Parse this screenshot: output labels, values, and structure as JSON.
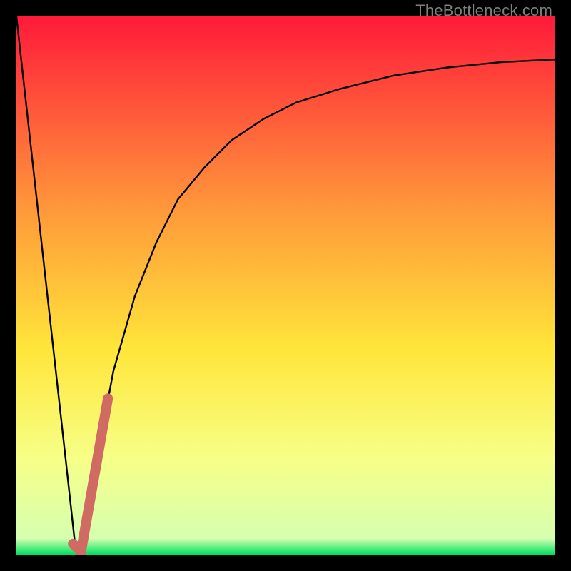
{
  "watermark": "TheBottleneck.com",
  "colors": {
    "frame": "#000000",
    "grad_top": "#ff1a3a",
    "grad_mid1": "#ff993a",
    "grad_mid2": "#ffe63a",
    "grad_mid3": "#f7ff87",
    "grad_bottom": "#00e060",
    "curve": "#000000",
    "marker": "#cf6b62",
    "watermark": "#7f7f7f"
  },
  "chart_data": {
    "type": "line",
    "title": "",
    "xlabel": "",
    "ylabel": "",
    "xlim": [
      0,
      100
    ],
    "ylim": [
      0,
      100
    ],
    "series": [
      {
        "name": "bottleneck-curve",
        "x": [
          0,
          3,
          6,
          9,
          11,
          13,
          15,
          18,
          22,
          26,
          30,
          35,
          40,
          46,
          52,
          60,
          70,
          80,
          90,
          100
        ],
        "y": [
          100,
          73,
          46,
          19,
          1,
          6,
          18,
          34,
          48,
          58,
          66,
          72,
          77,
          81,
          84,
          86.5,
          89,
          90.5,
          91.5,
          92
        ]
      }
    ],
    "marker_segment": {
      "name": "highlighted-range",
      "points": [
        [
          10.5,
          2.0
        ],
        [
          12.0,
          0.5
        ],
        [
          17.0,
          29.0
        ]
      ]
    }
  }
}
